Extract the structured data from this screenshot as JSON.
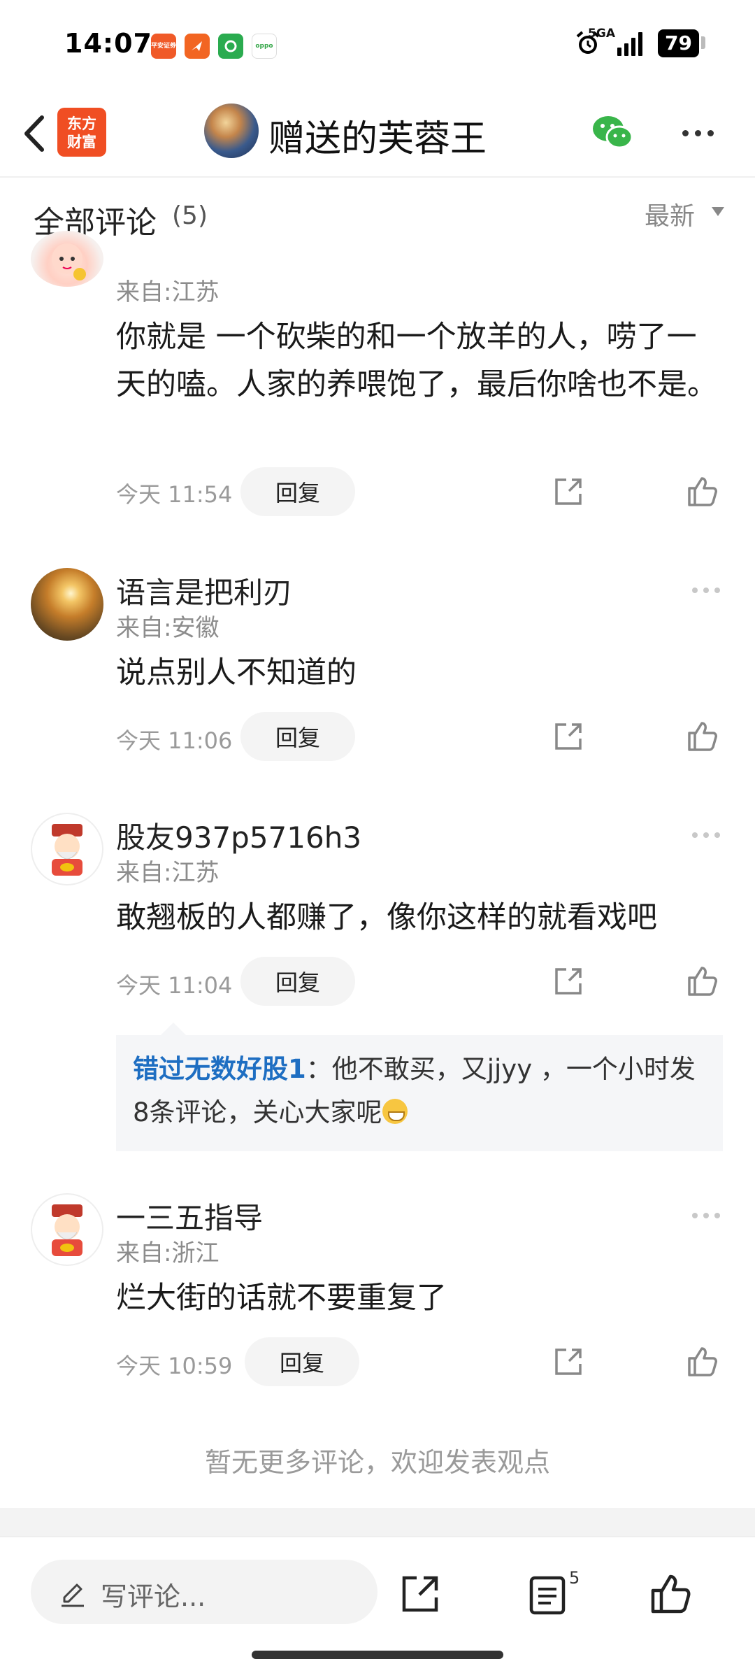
{
  "status": {
    "time": "14:07",
    "apps": [
      {
        "label": "平安证券",
        "color": "#f05a28"
      },
      {
        "label": "",
        "color": "#f26522"
      },
      {
        "label": "",
        "color": "#2aab4f"
      },
      {
        "label": "oppo",
        "color": "#38a84b"
      }
    ],
    "network": "5GA",
    "battery": "79"
  },
  "header": {
    "logo_text": "东方\n财富",
    "title": "赠送的芙蓉王"
  },
  "section": {
    "title": "全部评论",
    "count": "(5)",
    "sort": "最新"
  },
  "comments": [
    {
      "name": "",
      "from": "来自:江苏",
      "text": "你就是 一个砍柴的和一个放羊的人，唠了一天的嗑。人家的养喂饱了，最后你啥也不是。",
      "time": "今天 11:54",
      "reply": "回复"
    },
    {
      "name": "语言是把利刃",
      "from": "来自:安徽",
      "text": "说点别人不知道的",
      "time": "今天 11:06",
      "reply": "回复"
    },
    {
      "name": "股友937p5716h3",
      "from": "来自:江苏",
      "text": "敢翘板的人都赚了，像你这样的就看戏吧",
      "time": "今天 11:04",
      "reply": "回复",
      "sub_reply": {
        "name": "错过无数好股1",
        "text": "：他不敢买，又jjyy ，一个小时发8条评论，关心大家呢"
      }
    },
    {
      "name": "一三五指导",
      "from": "来自:浙江",
      "text": "烂大街的话就不要重复了",
      "time": "今天 10:59",
      "reply": "回复"
    }
  ],
  "no_more": "暂无更多评论，欢迎发表观点",
  "bottom": {
    "placeholder": "写评论...",
    "comment_count": "5"
  }
}
